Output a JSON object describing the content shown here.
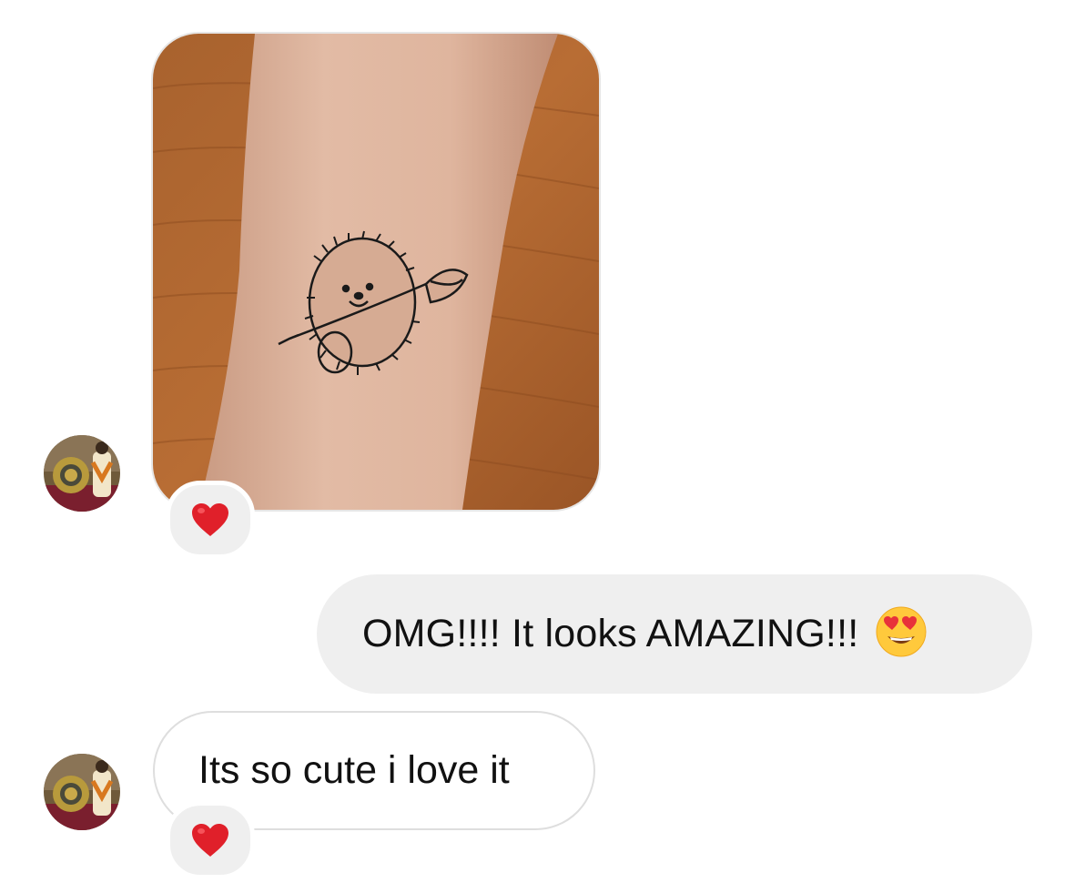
{
  "conversation": {
    "messages": [
      {
        "sender": "other",
        "type": "photo",
        "image_icon": "hedgehog-tattoo-photo",
        "reaction": "red-heart"
      },
      {
        "sender": "me",
        "type": "text",
        "text": "OMG!!!! It looks AMAZING!!!",
        "emoji": "heart-eyes-emoji"
      },
      {
        "sender": "other",
        "type": "text",
        "text": "Its so cute i love it",
        "reaction": "red-heart"
      }
    ]
  },
  "colors": {
    "sent_bubble": "#efefef",
    "received_bubble_border": "#dedede",
    "reaction_background": "#efefef",
    "heart": "#e0202a",
    "background": "#ffffff"
  }
}
